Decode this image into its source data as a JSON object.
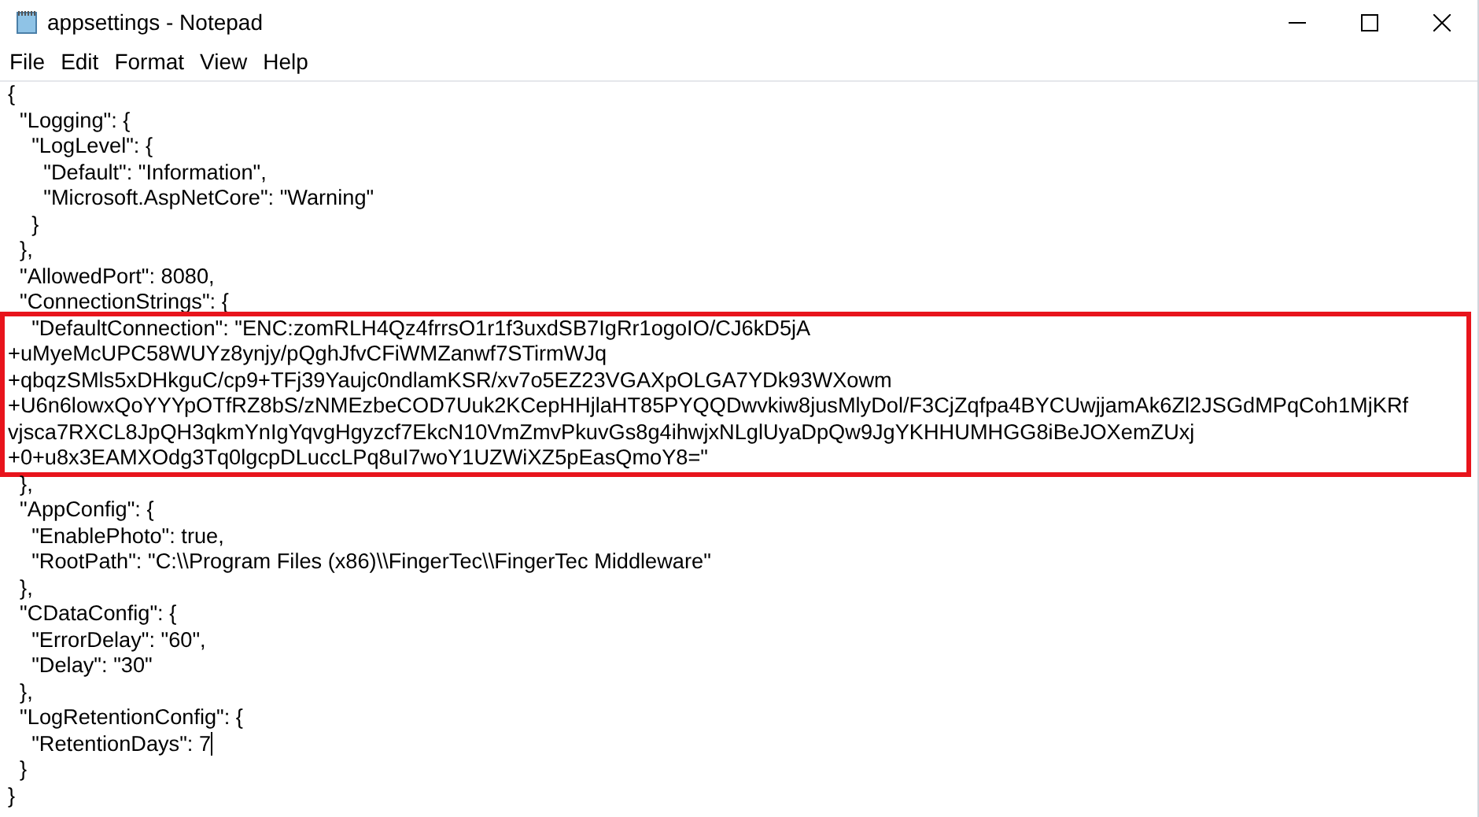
{
  "window": {
    "title": "appsettings - Notepad"
  },
  "menu": [
    {
      "label": "File"
    },
    {
      "label": "Edit"
    },
    {
      "label": "Format"
    },
    {
      "label": "View"
    },
    {
      "label": "Help"
    }
  ],
  "editor": {
    "lines": [
      {
        "text": "{",
        "highlighted": false
      },
      {
        "text": "  \"Logging\": {",
        "highlighted": false
      },
      {
        "text": "    \"LogLevel\": {",
        "highlighted": false
      },
      {
        "text": "      \"Default\": \"Information\",",
        "highlighted": false
      },
      {
        "text": "      \"Microsoft.AspNetCore\": \"Warning\"",
        "highlighted": false
      },
      {
        "text": "    }",
        "highlighted": false
      },
      {
        "text": "  },",
        "highlighted": false
      },
      {
        "text": "  \"AllowedPort\": 8080,",
        "highlighted": false
      },
      {
        "text": "  \"ConnectionStrings\": {",
        "highlighted": false
      },
      {
        "text": "    \"DefaultConnection\": \"ENC:zomRLH4Qz4frrsO1r1f3uxdSB7IgRr1ogoIO/CJ6kD5jA",
        "highlighted": true
      },
      {
        "text": "+uMyeMcUPC58WUYz8ynjy/pQghJfvCFiWMZanwf7STirmWJq",
        "highlighted": true
      },
      {
        "text": "+qbqzSMls5xDHkguC/cp9+TFj39Yaujc0ndlamKSR/xv7o5EZ23VGAXpOLGA7YDk93WXowm",
        "highlighted": true
      },
      {
        "text": "+U6n6lowxQoYYYpOTfRZ8bS/zNMEzbeCOD7Uuk2KCepHHjlaHT85PYQQDwvkiw8jusMlyDol/F3CjZqfpa4BYCUwjjamAk6Zl2JSGdMPqCoh1MjKRf",
        "highlighted": true
      },
      {
        "text": "vjsca7RXCL8JpQH3qkmYnIgYqvgHgyzcf7EkcN10VmZmvPkuvGs8g4ihwjxNLglUyaDpQw9JgYKHHUMHGG8iBeJOXemZUxj",
        "highlighted": true
      },
      {
        "text": "+0+u8x3EAMXOdg3Tq0lgcpDLuccLPq8uI7woY1UZWiXZ5pEasQmoY8=\"",
        "highlighted": true
      },
      {
        "text": "  },",
        "highlighted": false
      },
      {
        "text": "  \"AppConfig\": {",
        "highlighted": false
      },
      {
        "text": "    \"EnablePhoto\": true,",
        "highlighted": false
      },
      {
        "text": "    \"RootPath\": \"C:\\\\Program Files (x86)\\\\FingerTec\\\\FingerTec Middleware\"",
        "highlighted": false
      },
      {
        "text": "  },",
        "highlighted": false
      },
      {
        "text": "  \"CDataConfig\": {",
        "highlighted": false
      },
      {
        "text": "    \"ErrorDelay\": \"60\",",
        "highlighted": false
      },
      {
        "text": "    \"Delay\": \"30\"",
        "highlighted": false
      },
      {
        "text": "  },",
        "highlighted": false
      },
      {
        "text": "  \"LogRetentionConfig\": {",
        "highlighted": false
      },
      {
        "text": "    \"RetentionDays\": 7",
        "highlighted": false,
        "caret": true
      },
      {
        "text": "  }",
        "highlighted": false
      },
      {
        "text": "}",
        "highlighted": false
      }
    ]
  }
}
